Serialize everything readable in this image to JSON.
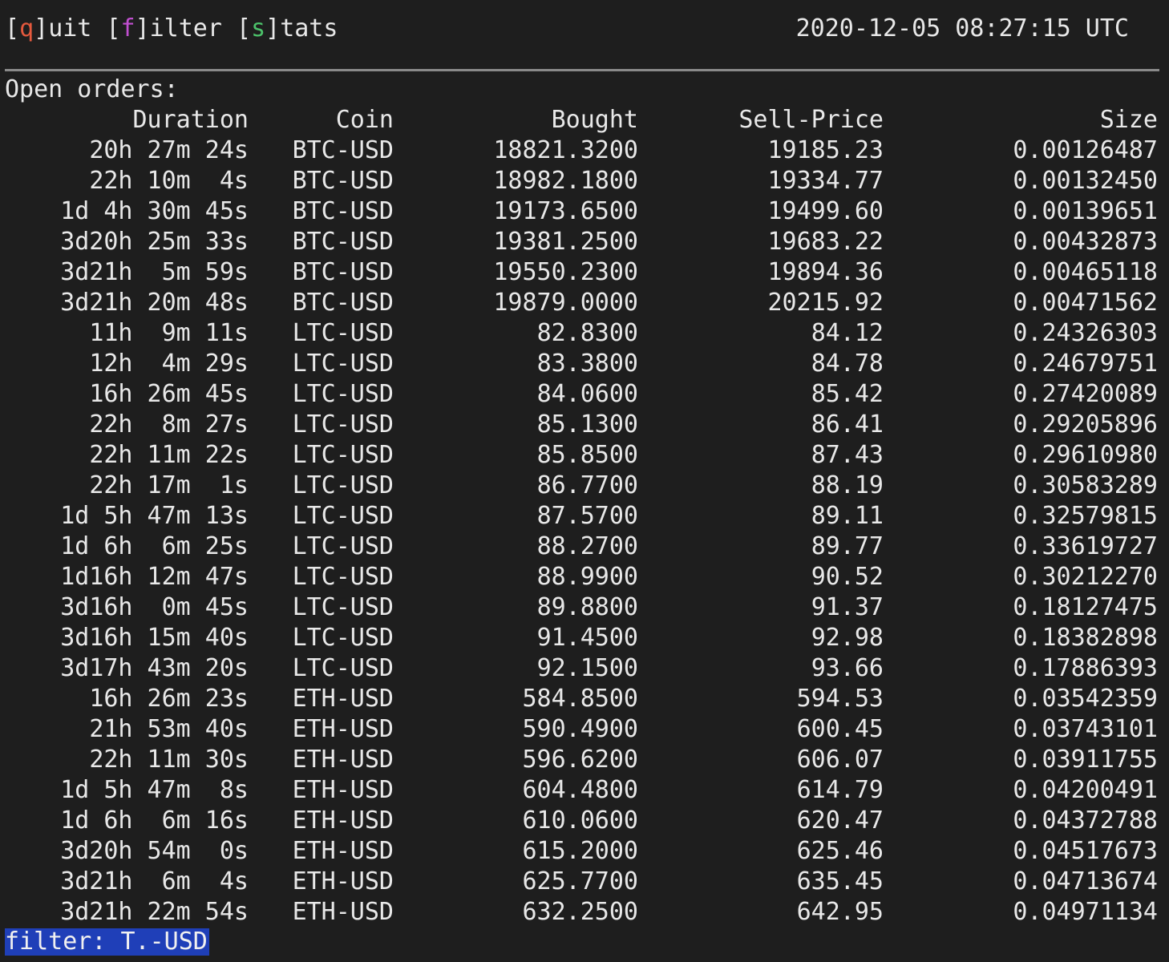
{
  "menu": {
    "quit": {
      "open": "[",
      "key": "q",
      "close": "]",
      "rest": "uit"
    },
    "filter": {
      "open": "[",
      "key": "f",
      "close": "]",
      "rest": "ilter"
    },
    "stats": {
      "open": "[",
      "key": "s",
      "close": "]",
      "rest": "tats"
    },
    "key_colors": {
      "q": "#e4593d",
      "f": "#c14fd0",
      "s": "#4cc26a"
    }
  },
  "timestamp": "2020-12-05 08:27:15 UTC",
  "orders": {
    "title": "Open orders:",
    "headers": [
      "Duration",
      "Coin",
      "Bought",
      "Sell-Price",
      "Size"
    ],
    "rows": [
      [
        "20h 27m 24s",
        "BTC-USD",
        "18821.3200",
        "19185.23",
        "0.00126487"
      ],
      [
        "22h 10m  4s",
        "BTC-USD",
        "18982.1800",
        "19334.77",
        "0.00132450"
      ],
      [
        "1d 4h 30m 45s",
        "BTC-USD",
        "19173.6500",
        "19499.60",
        "0.00139651"
      ],
      [
        "3d20h 25m 33s",
        "BTC-USD",
        "19381.2500",
        "19683.22",
        "0.00432873"
      ],
      [
        "3d21h  5m 59s",
        "BTC-USD",
        "19550.2300",
        "19894.36",
        "0.00465118"
      ],
      [
        "3d21h 20m 48s",
        "BTC-USD",
        "19879.0000",
        "20215.92",
        "0.00471562"
      ],
      [
        "11h  9m 11s",
        "LTC-USD",
        "82.8300",
        "84.12",
        "0.24326303"
      ],
      [
        "12h  4m 29s",
        "LTC-USD",
        "83.3800",
        "84.78",
        "0.24679751"
      ],
      [
        "16h 26m 45s",
        "LTC-USD",
        "84.0600",
        "85.42",
        "0.27420089"
      ],
      [
        "22h  8m 27s",
        "LTC-USD",
        "85.1300",
        "86.41",
        "0.29205896"
      ],
      [
        "22h 11m 22s",
        "LTC-USD",
        "85.8500",
        "87.43",
        "0.29610980"
      ],
      [
        "22h 17m  1s",
        "LTC-USD",
        "86.7700",
        "88.19",
        "0.30583289"
      ],
      [
        "1d 5h 47m 13s",
        "LTC-USD",
        "87.5700",
        "89.11",
        "0.32579815"
      ],
      [
        "1d 6h  6m 25s",
        "LTC-USD",
        "88.2700",
        "89.77",
        "0.33619727"
      ],
      [
        "1d16h 12m 47s",
        "LTC-USD",
        "88.9900",
        "90.52",
        "0.30212270"
      ],
      [
        "3d16h  0m 45s",
        "LTC-USD",
        "89.8800",
        "91.37",
        "0.18127475"
      ],
      [
        "3d16h 15m 40s",
        "LTC-USD",
        "91.4500",
        "92.98",
        "0.18382898"
      ],
      [
        "3d17h 43m 20s",
        "LTC-USD",
        "92.1500",
        "93.66",
        "0.17886393"
      ],
      [
        "16h 26m 23s",
        "ETH-USD",
        "584.8500",
        "594.53",
        "0.03542359"
      ],
      [
        "21h 53m 40s",
        "ETH-USD",
        "590.4900",
        "600.45",
        "0.03743101"
      ],
      [
        "22h 11m 30s",
        "ETH-USD",
        "596.6200",
        "606.07",
        "0.03911755"
      ],
      [
        "1d 5h 47m  8s",
        "ETH-USD",
        "604.4800",
        "614.79",
        "0.04200491"
      ],
      [
        "1d 6h  6m 16s",
        "ETH-USD",
        "610.0600",
        "620.47",
        "0.04372788"
      ],
      [
        "3d20h 54m  0s",
        "ETH-USD",
        "615.2000",
        "625.46",
        "0.04517673"
      ],
      [
        "3d21h  6m  4s",
        "ETH-USD",
        "625.7700",
        "635.45",
        "0.04713674"
      ],
      [
        "3d21h 22m 54s",
        "ETH-USD",
        "632.2500",
        "642.95",
        "0.04971134"
      ]
    ]
  },
  "filter_bar": {
    "text": "filter: T.-USD",
    "highlight_color": "#1f3fb8"
  }
}
